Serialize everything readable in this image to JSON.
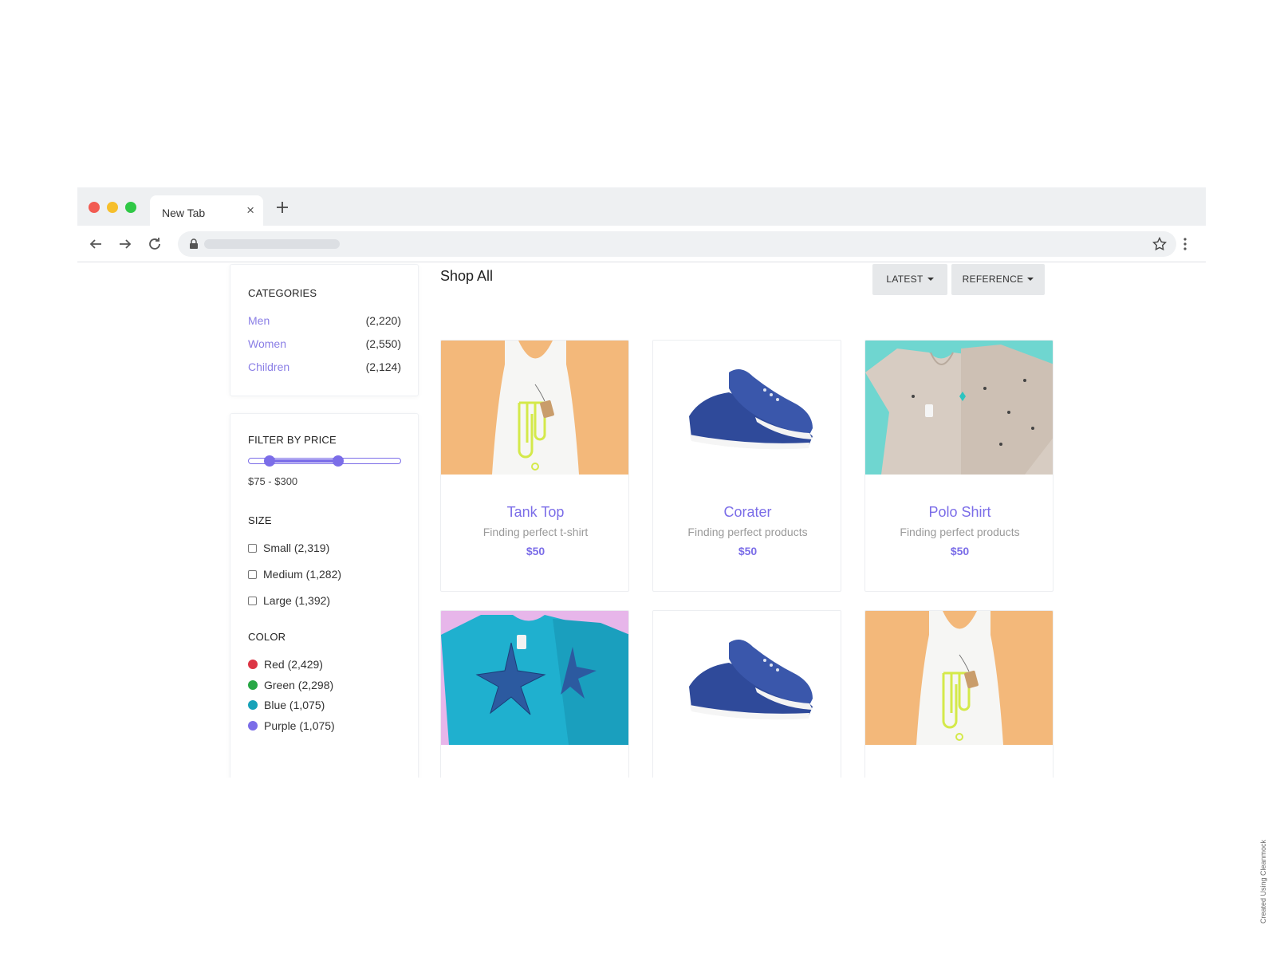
{
  "browser": {
    "tab_title": "New Tab",
    "close_glyph": "×"
  },
  "sidebar": {
    "categories_title": "CATEGORIES",
    "categories": [
      {
        "label": "Men",
        "count": "(2,220)"
      },
      {
        "label": "Women",
        "count": "(2,550)"
      },
      {
        "label": "Children",
        "count": "(2,124)"
      }
    ],
    "filter_title": "FILTER BY PRICE",
    "price_range": {
      "min": 75,
      "max": 300,
      "label": "$75 - $300"
    },
    "size_title": "SIZE",
    "sizes": [
      {
        "label": "Small (2,319)",
        "checked": false
      },
      {
        "label": "Medium (1,282)",
        "checked": false
      },
      {
        "label": "Large (1,392)",
        "checked": false
      }
    ],
    "color_title": "COLOR",
    "colors": [
      {
        "label": "Red (2,429)",
        "hex": "#dc3545"
      },
      {
        "label": "Green (2,298)",
        "hex": "#28a745"
      },
      {
        "label": "Blue (1,075)",
        "hex": "#17a2b8"
      },
      {
        "label": "Purple (1,075)",
        "hex": "#7b6de8"
      }
    ]
  },
  "main": {
    "title": "Shop All",
    "sort_latest": "LATEST",
    "sort_reference": "REFERENCE"
  },
  "products": [
    {
      "name": "Tank Top",
      "desc": "Finding perfect t-shirt",
      "price": "$50",
      "image": "tank-top-image"
    },
    {
      "name": "Corater",
      "desc": "Finding perfect products",
      "price": "$50",
      "image": "sneaker-image"
    },
    {
      "name": "Polo Shirt",
      "desc": "Finding perfect products",
      "price": "$50",
      "image": "polo-shirt-image"
    },
    {
      "name": "",
      "desc": "",
      "price": "",
      "image": "tshirt-image"
    },
    {
      "name": "",
      "desc": "",
      "price": "",
      "image": "sneaker-image"
    },
    {
      "name": "",
      "desc": "",
      "price": "",
      "image": "tank-top-image"
    }
  ],
  "theme": {
    "accent": "#7b6de8",
    "button_bg": "#e6e8ea"
  },
  "watermark": "Created Using Cleanmock"
}
